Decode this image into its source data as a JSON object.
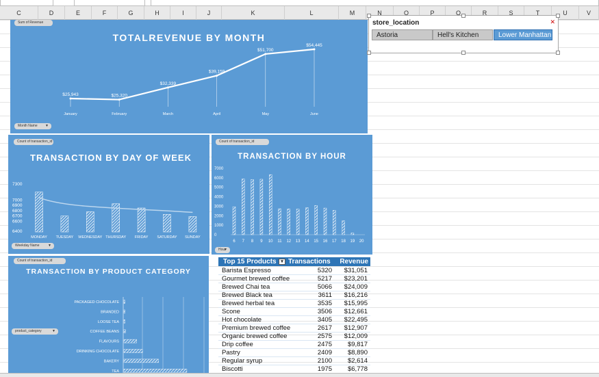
{
  "columns": [
    "C",
    "D",
    "E",
    "F",
    "G",
    "H",
    "I",
    "J",
    "K",
    "L",
    "M",
    "N",
    "O",
    "P",
    "Q",
    "R",
    "S",
    "T",
    "U",
    "V"
  ],
  "revenue_chart": {
    "field_button": "Sum of Revenue",
    "filter_button": "Month Name",
    "chart_data": {
      "type": "line",
      "title": "TOTALREVENUE BY MONTH",
      "categories": [
        "January",
        "February",
        "March",
        "April",
        "May",
        "June"
      ],
      "values": [
        25943,
        25320,
        32339,
        39159,
        51700,
        54445
      ],
      "data_labels": [
        "$25,943",
        "$25,320",
        "$32,339",
        "$39,159",
        "$51,700",
        "$54,445"
      ],
      "ylim": [
        20000,
        58000
      ],
      "grid": false
    }
  },
  "day_chart": {
    "field_button": "Count of transaction_id",
    "filter_button": "Weekday Name",
    "chart_data": {
      "type": "bar",
      "title": "TRANSACTION BY DAY OF WEEK",
      "categories": [
        "MONDAY",
        "TUESDAY",
        "WEDNESDAY",
        "THURSDAY",
        "FRIDAY",
        "SATURDAY",
        "SUNDAY"
      ],
      "values": [
        7150,
        6700,
        6780,
        6930,
        6850,
        6730,
        6690
      ],
      "ylim": [
        6400,
        7300
      ],
      "yticks": [
        "7300",
        "7000",
        "6900",
        "6800",
        "6700",
        "6600",
        "6400"
      ],
      "trendline": true
    }
  },
  "hour_chart": {
    "field_button": "Count of transaction_id",
    "filter_button": "Hour",
    "chart_data": {
      "type": "bar",
      "title": "TRANSACTION BY HOUR",
      "categories": [
        "6",
        "7",
        "8",
        "9",
        "10",
        "11",
        "12",
        "13",
        "14",
        "15",
        "16",
        "17",
        "18",
        "19",
        "20"
      ],
      "values": [
        2950,
        5880,
        5820,
        5850,
        6340,
        2740,
        2720,
        2700,
        2850,
        3080,
        2810,
        2570,
        1470,
        180,
        0
      ],
      "ylim": [
        0,
        7000
      ],
      "yticks": [
        "7000",
        "6000",
        "5000",
        "4000",
        "3000",
        "2000",
        "1000",
        "0"
      ]
    }
  },
  "category_chart": {
    "field_button": "Count of transaction_id",
    "filter_button": "product_category",
    "chart_data": {
      "type": "bar",
      "orientation": "horizontal",
      "title": "TRANSACTION BY PRODUCT CATEGORY",
      "categories": [
        "PACKAGED CHOCOLATE",
        "BRANDED",
        "LOOSE TEA",
        "COFFEE BEANS",
        "FLAVOURS",
        "DRINKING CHOCOLATE",
        "BAKERY",
        "TEA"
      ],
      "values": [
        120,
        180,
        240,
        420,
        3200,
        4700,
        8700,
        15800
      ]
    }
  },
  "slicer": {
    "title": "store_location",
    "items": [
      "Astoria",
      "Hell's Kitchen",
      "Lower Manhattan"
    ],
    "selected": "Lower Manhattan"
  },
  "pivot": {
    "headers": [
      "Top 15 Products",
      "Transactions",
      "Revenue"
    ],
    "rows": [
      {
        "name": "Barista Espresso",
        "tx": "5320",
        "rev": "$31,051"
      },
      {
        "name": "Gourmet brewed coffee",
        "tx": "5217",
        "rev": "$23,201"
      },
      {
        "name": "Brewed Chai tea",
        "tx": "5066",
        "rev": "$24,009"
      },
      {
        "name": "Brewed Black tea",
        "tx": "3611",
        "rev": "$16,216"
      },
      {
        "name": "Brewed herbal tea",
        "tx": "3535",
        "rev": "$15,995"
      },
      {
        "name": "Scone",
        "tx": "3506",
        "rev": "$12,661"
      },
      {
        "name": "Hot chocolate",
        "tx": "3405",
        "rev": "$22,495"
      },
      {
        "name": "Premium brewed coffee",
        "tx": "2617",
        "rev": "$12,907"
      },
      {
        "name": "Organic brewed coffee",
        "tx": "2575",
        "rev": "$12,009"
      },
      {
        "name": "Drip coffee",
        "tx": "2475",
        "rev": "$9,817"
      },
      {
        "name": "Pastry",
        "tx": "2409",
        "rev": "$8,890"
      },
      {
        "name": "Regular syrup",
        "tx": "2100",
        "rev": "$2,614"
      },
      {
        "name": "Biscotti",
        "tx": "1975",
        "rev": "$6,778"
      }
    ]
  },
  "colors": {
    "panel": "#5b9bd5",
    "header_blue": "#2e75b6",
    "accent_white": "#ffffff"
  }
}
